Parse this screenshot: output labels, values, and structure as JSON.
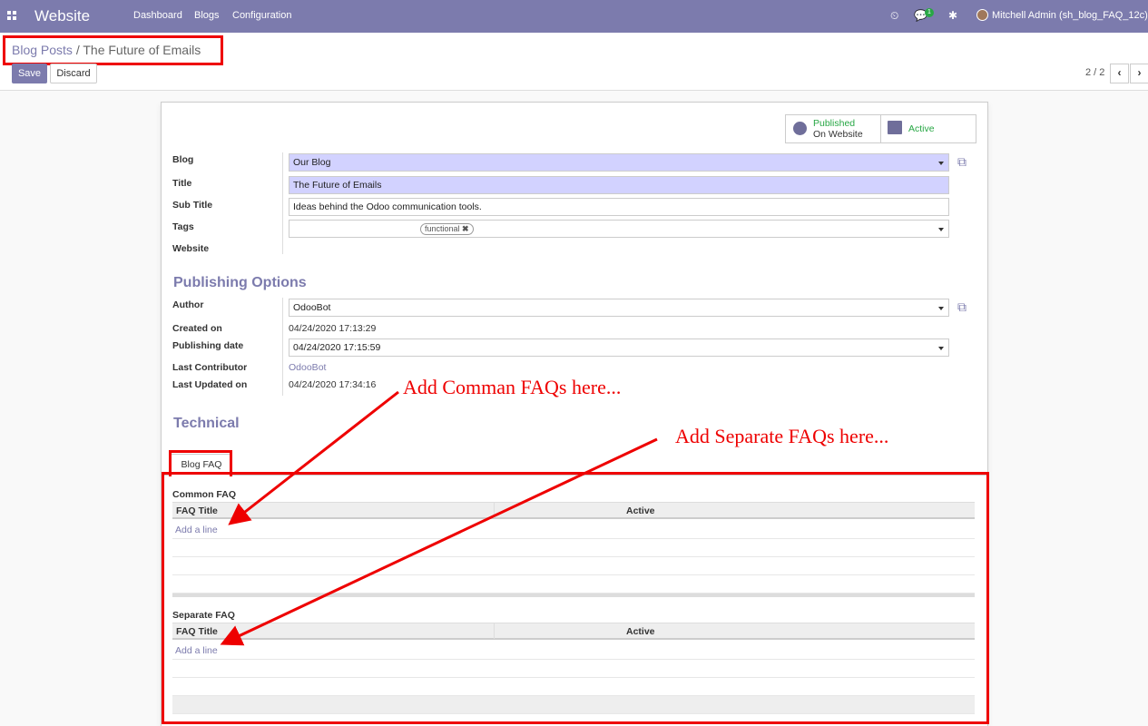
{
  "navbar": {
    "app_title": "Website",
    "menu": [
      "Dashboard",
      "Blogs",
      "Configuration"
    ],
    "message_count": "1",
    "user": "Mitchell Admin (sh_blog_FAQ_12c)",
    "color": "#7c7bad"
  },
  "breadcrumb": {
    "parent": "Blog Posts",
    "separator": "/",
    "current": "The Future of Emails"
  },
  "actions": {
    "save": "Save",
    "discard": "Discard"
  },
  "pager": {
    "value": "2 / 2",
    "prev": "‹",
    "next": "›"
  },
  "stat_buttons": {
    "published": {
      "line1": "Published",
      "line2": "On Website"
    },
    "active": {
      "label": "Active"
    }
  },
  "fields": {
    "blog": {
      "label": "Blog",
      "value": "Our Blog"
    },
    "title": {
      "label": "Title",
      "value": "The Future of Emails"
    },
    "subtitle": {
      "label": "Sub Title",
      "value": "Ideas behind the Odoo communication tools."
    },
    "tags": {
      "label": "Tags",
      "values": [
        "functional"
      ]
    },
    "website": {
      "label": "Website",
      "value": ""
    }
  },
  "publishing": {
    "section_title": "Publishing Options",
    "author": {
      "label": "Author",
      "value": "OdooBot"
    },
    "created_on": {
      "label": "Created on",
      "value": "04/24/2020 17:13:29"
    },
    "publishing_date": {
      "label": "Publishing date",
      "value": "04/24/2020 17:15:59"
    },
    "last_contributor": {
      "label": "Last Contributor",
      "value": "OdooBot"
    },
    "last_updated_on": {
      "label": "Last Updated on",
      "value": "04/24/2020 17:34:16"
    }
  },
  "technical": {
    "section_title": "Technical"
  },
  "tabs": [
    "Blog FAQ"
  ],
  "common_faq": {
    "title": "Common FAQ",
    "columns": [
      "FAQ Title",
      "Active"
    ],
    "add_line": "Add a line"
  },
  "separate_faq": {
    "title": "Separate FAQ",
    "columns": [
      "FAQ Title",
      "Active"
    ],
    "add_line": "Add a line"
  },
  "annotations": {
    "common": "Add Comman FAQs  here...",
    "separate": "Add Separate FAQs here...",
    "color": "#ee0000"
  }
}
